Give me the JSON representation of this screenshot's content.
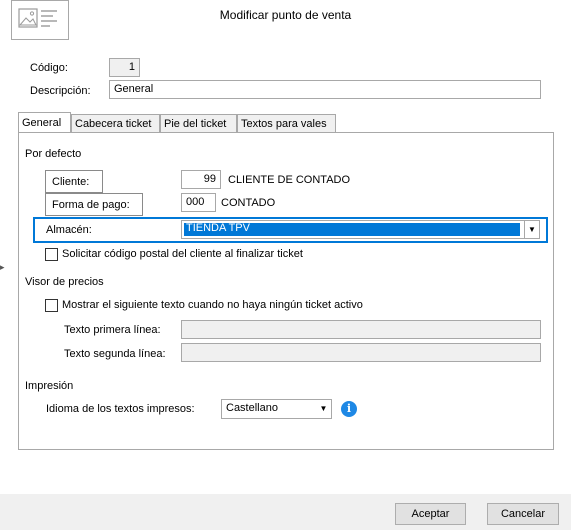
{
  "dialog": {
    "title": "Modificar punto de venta"
  },
  "header": {
    "codigo_label": "Código:",
    "codigo_value": "1",
    "descripcion_label": "Descripción:",
    "descripcion_value": "General"
  },
  "tabs": [
    {
      "label": "General",
      "active": true
    },
    {
      "label": "Cabecera ticket",
      "active": false
    },
    {
      "label": "Pie del ticket",
      "active": false
    },
    {
      "label": "Textos para vales",
      "active": false
    }
  ],
  "por_defecto": {
    "section_label": "Por defecto",
    "cliente_button": "Cliente:",
    "cliente_code": "99",
    "cliente_name": "CLIENTE DE CONTADO",
    "forma_pago_button": "Forma de pago:",
    "forma_pago_code": "000",
    "forma_pago_name": "CONTADO",
    "almacen_label": "Almacén:",
    "almacen_value": "TIENDA TPV",
    "solicitar_cp_label": "Solicitar código postal del cliente al finalizar ticket",
    "solicitar_cp_checked": false
  },
  "visor": {
    "section_label": "Visor de precios",
    "mostrar_label": "Mostrar el siguiente texto cuando no haya ningún ticket activo",
    "mostrar_checked": false,
    "linea1_label": "Texto primera línea:",
    "linea1_value": "",
    "linea2_label": "Texto segunda línea:",
    "linea2_value": ""
  },
  "impresion": {
    "section_label": "Impresión",
    "idioma_label": "Idioma de los textos impresos:",
    "idioma_value": "Castellano"
  },
  "footer": {
    "aceptar": "Aceptar",
    "cancelar": "Cancelar"
  },
  "colors": {
    "selection": "#0078d7",
    "focus_border": "#0078d7",
    "info_icon": "#1e88e5"
  },
  "icons": {
    "dialog_icon": "image-list-icon",
    "info_icon": "info-icon",
    "dropdown": "chevron-down-icon"
  }
}
